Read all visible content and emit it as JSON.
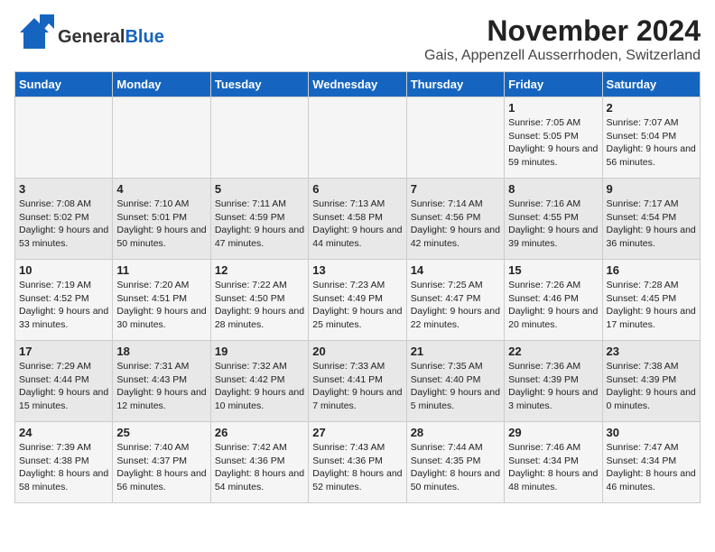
{
  "header": {
    "logo_line1": "General",
    "logo_line2": "Blue",
    "month_title": "November 2024",
    "location": "Gais, Appenzell Ausserrhoden, Switzerland"
  },
  "weekdays": [
    "Sunday",
    "Monday",
    "Tuesday",
    "Wednesday",
    "Thursday",
    "Friday",
    "Saturday"
  ],
  "weeks": [
    [
      {
        "day": "",
        "info": ""
      },
      {
        "day": "",
        "info": ""
      },
      {
        "day": "",
        "info": ""
      },
      {
        "day": "",
        "info": ""
      },
      {
        "day": "",
        "info": ""
      },
      {
        "day": "1",
        "info": "Sunrise: 7:05 AM\nSunset: 5:05 PM\nDaylight: 9 hours and 59 minutes."
      },
      {
        "day": "2",
        "info": "Sunrise: 7:07 AM\nSunset: 5:04 PM\nDaylight: 9 hours and 56 minutes."
      }
    ],
    [
      {
        "day": "3",
        "info": "Sunrise: 7:08 AM\nSunset: 5:02 PM\nDaylight: 9 hours and 53 minutes."
      },
      {
        "day": "4",
        "info": "Sunrise: 7:10 AM\nSunset: 5:01 PM\nDaylight: 9 hours and 50 minutes."
      },
      {
        "day": "5",
        "info": "Sunrise: 7:11 AM\nSunset: 4:59 PM\nDaylight: 9 hours and 47 minutes."
      },
      {
        "day": "6",
        "info": "Sunrise: 7:13 AM\nSunset: 4:58 PM\nDaylight: 9 hours and 44 minutes."
      },
      {
        "day": "7",
        "info": "Sunrise: 7:14 AM\nSunset: 4:56 PM\nDaylight: 9 hours and 42 minutes."
      },
      {
        "day": "8",
        "info": "Sunrise: 7:16 AM\nSunset: 4:55 PM\nDaylight: 9 hours and 39 minutes."
      },
      {
        "day": "9",
        "info": "Sunrise: 7:17 AM\nSunset: 4:54 PM\nDaylight: 9 hours and 36 minutes."
      }
    ],
    [
      {
        "day": "10",
        "info": "Sunrise: 7:19 AM\nSunset: 4:52 PM\nDaylight: 9 hours and 33 minutes."
      },
      {
        "day": "11",
        "info": "Sunrise: 7:20 AM\nSunset: 4:51 PM\nDaylight: 9 hours and 30 minutes."
      },
      {
        "day": "12",
        "info": "Sunrise: 7:22 AM\nSunset: 4:50 PM\nDaylight: 9 hours and 28 minutes."
      },
      {
        "day": "13",
        "info": "Sunrise: 7:23 AM\nSunset: 4:49 PM\nDaylight: 9 hours and 25 minutes."
      },
      {
        "day": "14",
        "info": "Sunrise: 7:25 AM\nSunset: 4:47 PM\nDaylight: 9 hours and 22 minutes."
      },
      {
        "day": "15",
        "info": "Sunrise: 7:26 AM\nSunset: 4:46 PM\nDaylight: 9 hours and 20 minutes."
      },
      {
        "day": "16",
        "info": "Sunrise: 7:28 AM\nSunset: 4:45 PM\nDaylight: 9 hours and 17 minutes."
      }
    ],
    [
      {
        "day": "17",
        "info": "Sunrise: 7:29 AM\nSunset: 4:44 PM\nDaylight: 9 hours and 15 minutes."
      },
      {
        "day": "18",
        "info": "Sunrise: 7:31 AM\nSunset: 4:43 PM\nDaylight: 9 hours and 12 minutes."
      },
      {
        "day": "19",
        "info": "Sunrise: 7:32 AM\nSunset: 4:42 PM\nDaylight: 9 hours and 10 minutes."
      },
      {
        "day": "20",
        "info": "Sunrise: 7:33 AM\nSunset: 4:41 PM\nDaylight: 9 hours and 7 minutes."
      },
      {
        "day": "21",
        "info": "Sunrise: 7:35 AM\nSunset: 4:40 PM\nDaylight: 9 hours and 5 minutes."
      },
      {
        "day": "22",
        "info": "Sunrise: 7:36 AM\nSunset: 4:39 PM\nDaylight: 9 hours and 3 minutes."
      },
      {
        "day": "23",
        "info": "Sunrise: 7:38 AM\nSunset: 4:39 PM\nDaylight: 9 hours and 0 minutes."
      }
    ],
    [
      {
        "day": "24",
        "info": "Sunrise: 7:39 AM\nSunset: 4:38 PM\nDaylight: 8 hours and 58 minutes."
      },
      {
        "day": "25",
        "info": "Sunrise: 7:40 AM\nSunset: 4:37 PM\nDaylight: 8 hours and 56 minutes."
      },
      {
        "day": "26",
        "info": "Sunrise: 7:42 AM\nSunset: 4:36 PM\nDaylight: 8 hours and 54 minutes."
      },
      {
        "day": "27",
        "info": "Sunrise: 7:43 AM\nSunset: 4:36 PM\nDaylight: 8 hours and 52 minutes."
      },
      {
        "day": "28",
        "info": "Sunrise: 7:44 AM\nSunset: 4:35 PM\nDaylight: 8 hours and 50 minutes."
      },
      {
        "day": "29",
        "info": "Sunrise: 7:46 AM\nSunset: 4:34 PM\nDaylight: 8 hours and 48 minutes."
      },
      {
        "day": "30",
        "info": "Sunrise: 7:47 AM\nSunset: 4:34 PM\nDaylight: 8 hours and 46 minutes."
      }
    ]
  ]
}
